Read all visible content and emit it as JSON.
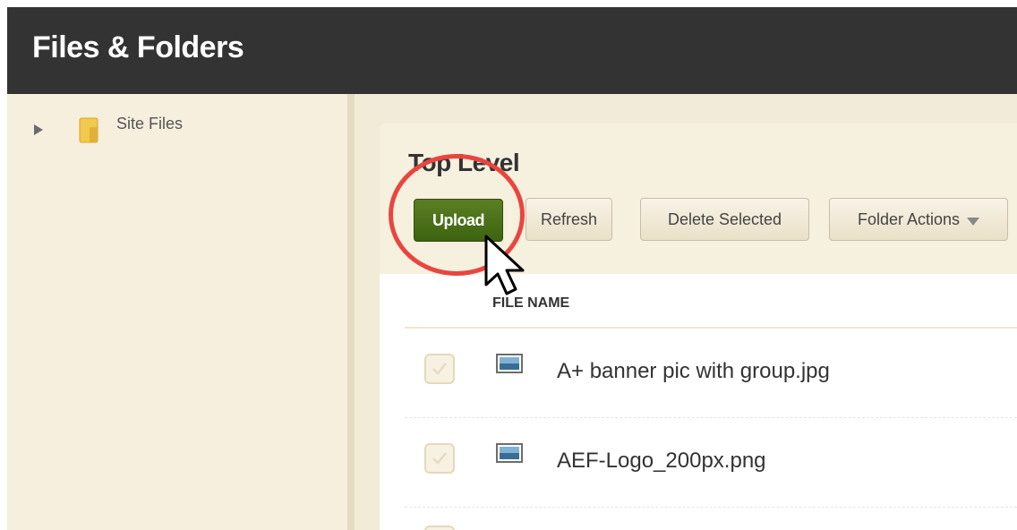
{
  "header": {
    "title": "Files & Folders"
  },
  "sidebar": {
    "items": [
      {
        "label": "Site Files"
      }
    ]
  },
  "main": {
    "title": "Top Level",
    "toolbar": {
      "upload_label": "Upload",
      "refresh_label": "Refresh",
      "delete_label": "Delete Selected",
      "folder_actions_label": "Folder Actions"
    },
    "table": {
      "columns": [
        "FILE NAME"
      ],
      "rows": [
        {
          "name": "A+ banner pic with group.jpg"
        },
        {
          "name": "AEF-Logo_200px.png"
        }
      ]
    }
  },
  "colors": {
    "topbar": "#333333",
    "upload_button": "#4a7019",
    "highlight_ring": "#e9453f",
    "panel_bg": "#f6f0de"
  }
}
